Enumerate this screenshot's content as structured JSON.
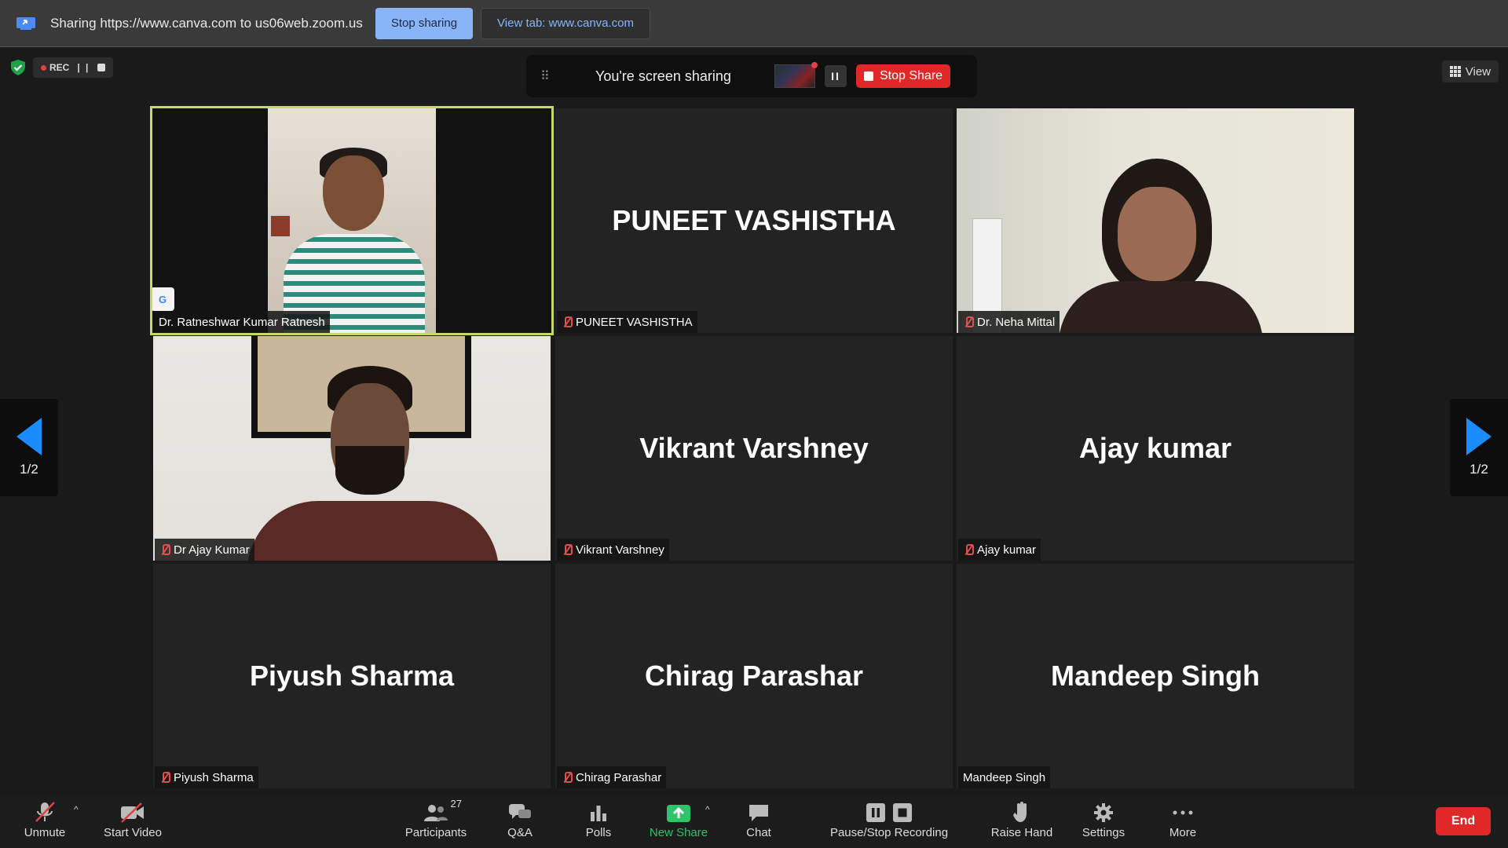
{
  "share_bar": {
    "sharing_text": "Sharing https://www.canva.com to us06web.zoom.us",
    "stop_sharing": "Stop sharing",
    "view_tab": "View tab: www.canva.com"
  },
  "status": {
    "rec_label": "REC"
  },
  "share_pill": {
    "text": "You're screen sharing",
    "stop_share": "Stop Share"
  },
  "view_button": "View",
  "pagination": {
    "left": "1/2",
    "right": "1/2"
  },
  "participants": [
    {
      "name": "Dr. Ratneshwar Kumar Ratnesh",
      "video": true,
      "muted": false,
      "active": true
    },
    {
      "name": "PUNEET VASHISTHA",
      "video": false,
      "muted": true
    },
    {
      "name": "Dr. Neha Mittal",
      "video": true,
      "muted": true
    },
    {
      "name": "Dr Ajay Kumar",
      "video": true,
      "muted": true
    },
    {
      "name": "Vikrant Varshney",
      "video": false,
      "muted": true
    },
    {
      "name": "Ajay kumar",
      "video": false,
      "muted": true
    },
    {
      "name": "Piyush Sharma",
      "video": false,
      "muted": true
    },
    {
      "name": "Chirag Parashar",
      "video": false,
      "muted": true
    },
    {
      "name": "Mandeep Singh",
      "video": false,
      "muted": false
    }
  ],
  "toolbar": {
    "unmute": "Unmute",
    "start_video": "Start Video",
    "participants": "Participants",
    "participants_count": "27",
    "qa": "Q&A",
    "polls": "Polls",
    "new_share": "New Share",
    "chat": "Chat",
    "pause_stop_recording": "Pause/Stop Recording",
    "raise_hand": "Raise Hand",
    "settings": "Settings",
    "more": "More",
    "end": "End"
  },
  "colors": {
    "accent_blue": "#1a8cff",
    "end_red": "#e02828",
    "active_border": "#c7d86a",
    "share_green": "#2ec46a"
  }
}
